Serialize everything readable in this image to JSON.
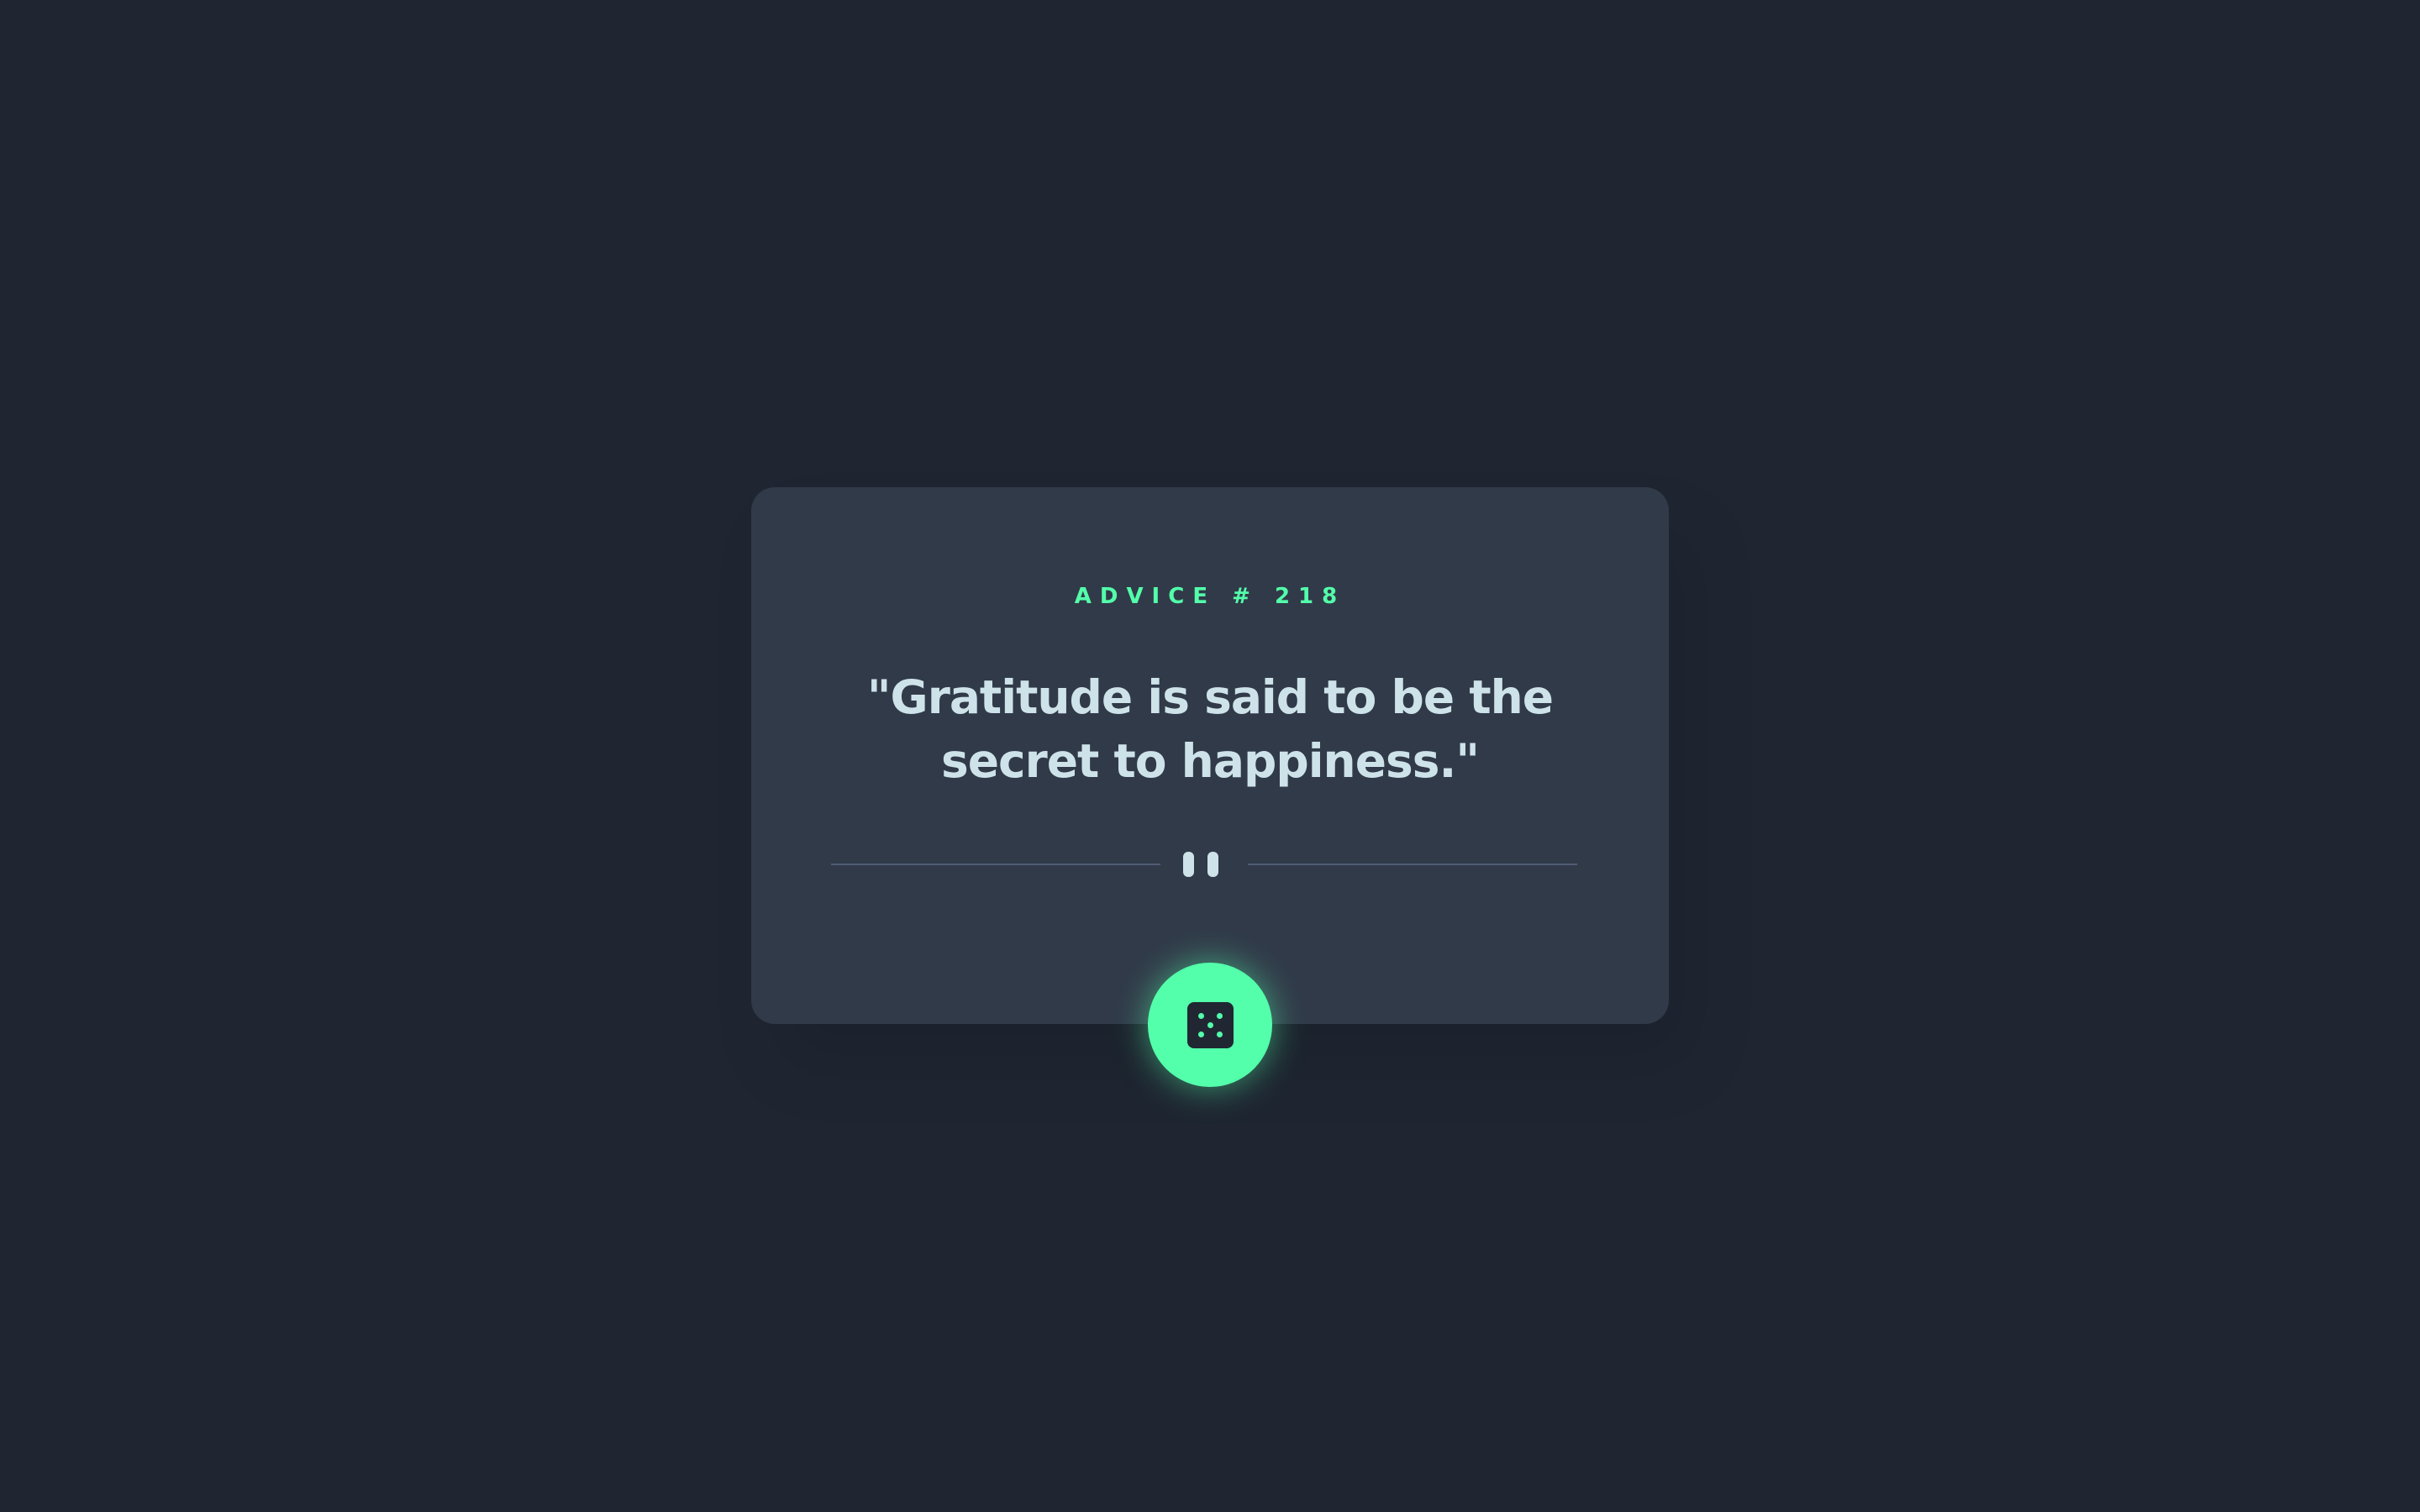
{
  "advice": {
    "label": "ADVICE # 218",
    "quote": "\"Gratitude is said to be the secret to happiness.\""
  },
  "divider": {
    "icon": "pause-icon"
  },
  "button": {
    "icon": "dice-icon"
  },
  "colors": {
    "background": "#1f2632",
    "card": "#313a49",
    "accent": "#53ffaa",
    "text": "#cee3e9",
    "divider_line": "#4f5d74"
  }
}
